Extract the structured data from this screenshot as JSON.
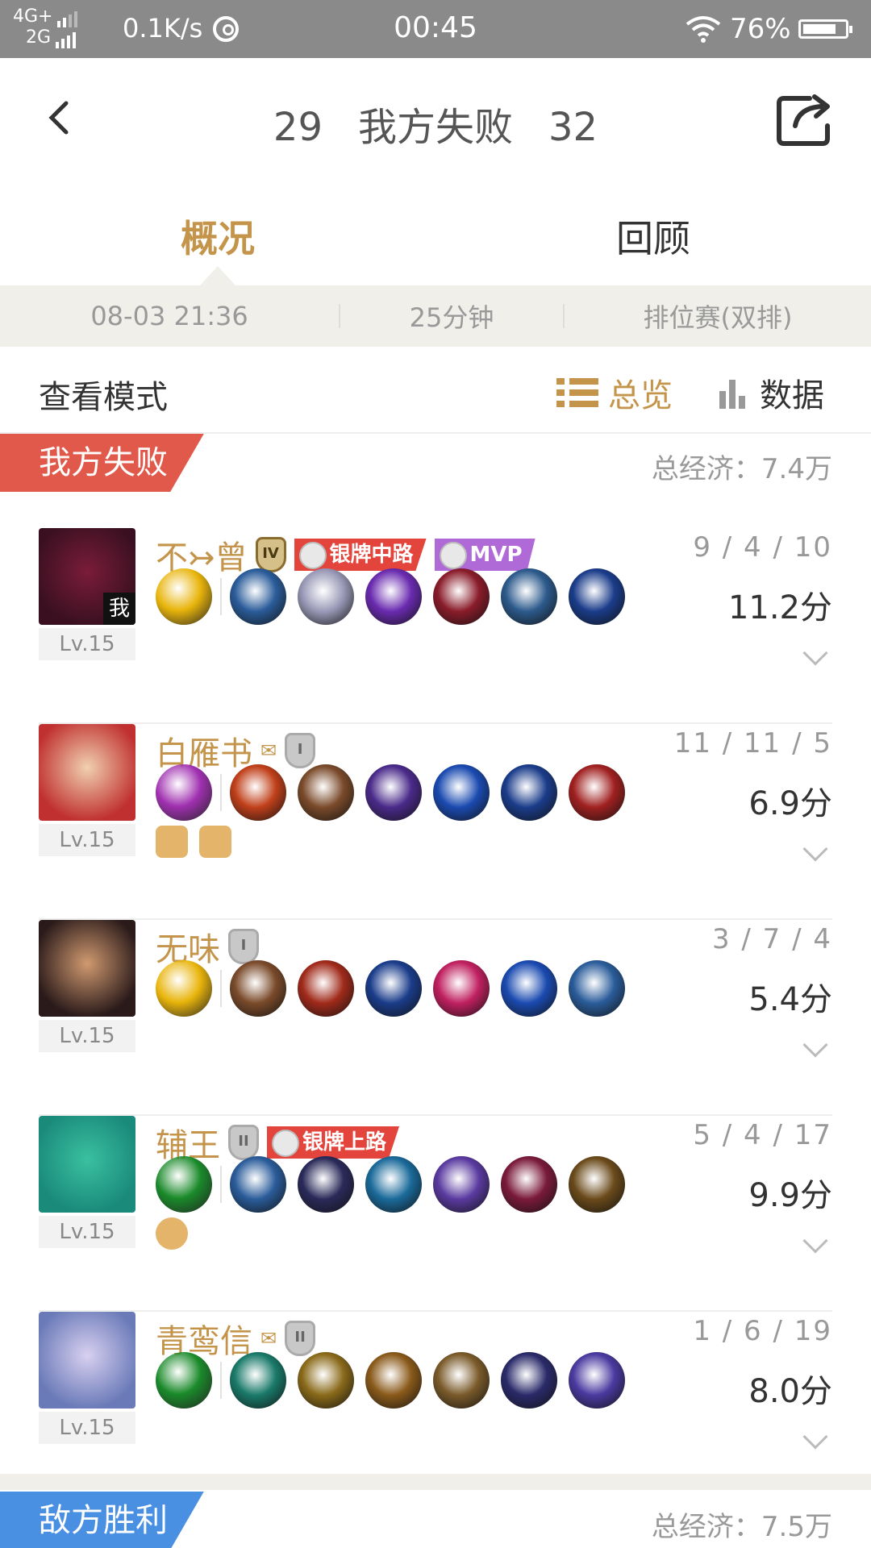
{
  "status_bar": {
    "network_top": "4G+",
    "network_bottom": "2G",
    "speed": "0.1K/s",
    "time": "00:45",
    "battery": "76%"
  },
  "header": {
    "our_score": "29",
    "result": "我方失败",
    "enemy_score": "32"
  },
  "tabs": [
    "概况",
    "回顾"
  ],
  "match_info": {
    "datetime": "08-03 21:36",
    "duration": "25分钟",
    "mode": "排位赛(双排)"
  },
  "view_mode": {
    "label": "查看模式",
    "overview": "总览",
    "data": "数据"
  },
  "our_team": {
    "label": "我方失败",
    "economy": "总经济：7.4万",
    "color": "#e0594a"
  },
  "enemy_team": {
    "label": "敌方胜利",
    "economy": "总经济：7.5万",
    "color": "#4a90e2"
  },
  "accent_color": "#c4944b",
  "players": [
    {
      "name": "不↣曾",
      "level": "Lv.15",
      "me_label": "我",
      "rank": "IV",
      "tags": [
        "银牌中路",
        "MVP"
      ],
      "kda": "9 / 4 / 10",
      "score": "11.2分",
      "avatar_colors": [
        "#3a1020",
        "#7a1c3a"
      ],
      "skill_color": "#e8b40a",
      "item_colors": [
        "#2a5c9a",
        "#9a9ab8",
        "#6a2bb0",
        "#8a1c2a",
        "#2c5a8c",
        "#1a3c8a"
      ]
    },
    {
      "name": "白雁书",
      "level": "Lv.15",
      "rank": "I",
      "mail": "✉",
      "kda": "11 / 11 / 5",
      "score": "6.9分",
      "avatar_colors": [
        "#c03030",
        "#f0d0b0"
      ],
      "skill_color": "#a030b0",
      "item_colors": [
        "#c0401a",
        "#7a4a2a",
        "#4a2a8a",
        "#1a4ab0",
        "#1a3c8a",
        "#a02020"
      ],
      "extras": [
        "sword",
        "helmet"
      ]
    },
    {
      "name": "无味",
      "level": "Lv.15",
      "rank": "I",
      "kda": "3 / 7 / 4",
      "score": "5.4分",
      "avatar_colors": [
        "#2a1a1a",
        "#d09a70"
      ],
      "skill_color": "#e8b40a",
      "item_colors": [
        "#7a4a2a",
        "#a02a1a",
        "#1a3c8a",
        "#c02060",
        "#1a4ab0",
        "#2a5c9a"
      ]
    },
    {
      "name": "辅王",
      "level": "Lv.15",
      "rank": "II",
      "tags": [
        "银牌上路"
      ],
      "kda": "5 / 4 / 17",
      "score": "9.9分",
      "avatar_colors": [
        "#1a8a7a",
        "#3ac0a0"
      ],
      "skill_color": "#1a8a2a",
      "item_colors": [
        "#2a5c9a",
        "#2a2a5a",
        "#1a6a9a",
        "#5a3aa0",
        "#7a1a3a",
        "#6a4a1a"
      ],
      "extras": [
        "shield"
      ]
    },
    {
      "name": "青鸾信",
      "level": "Lv.15",
      "rank": "II",
      "mail": "✉",
      "kda": "1 / 6 / 19",
      "score": "8.0分",
      "avatar_colors": [
        "#6a7ab8",
        "#d8d0f0"
      ],
      "skill_color": "#1a8a2a",
      "item_colors": [
        "#1a7a6a",
        "#8a6a1a",
        "#8a5a1a",
        "#7a5a2a",
        "#2a2a6a",
        "#4a3aa0"
      ]
    }
  ]
}
